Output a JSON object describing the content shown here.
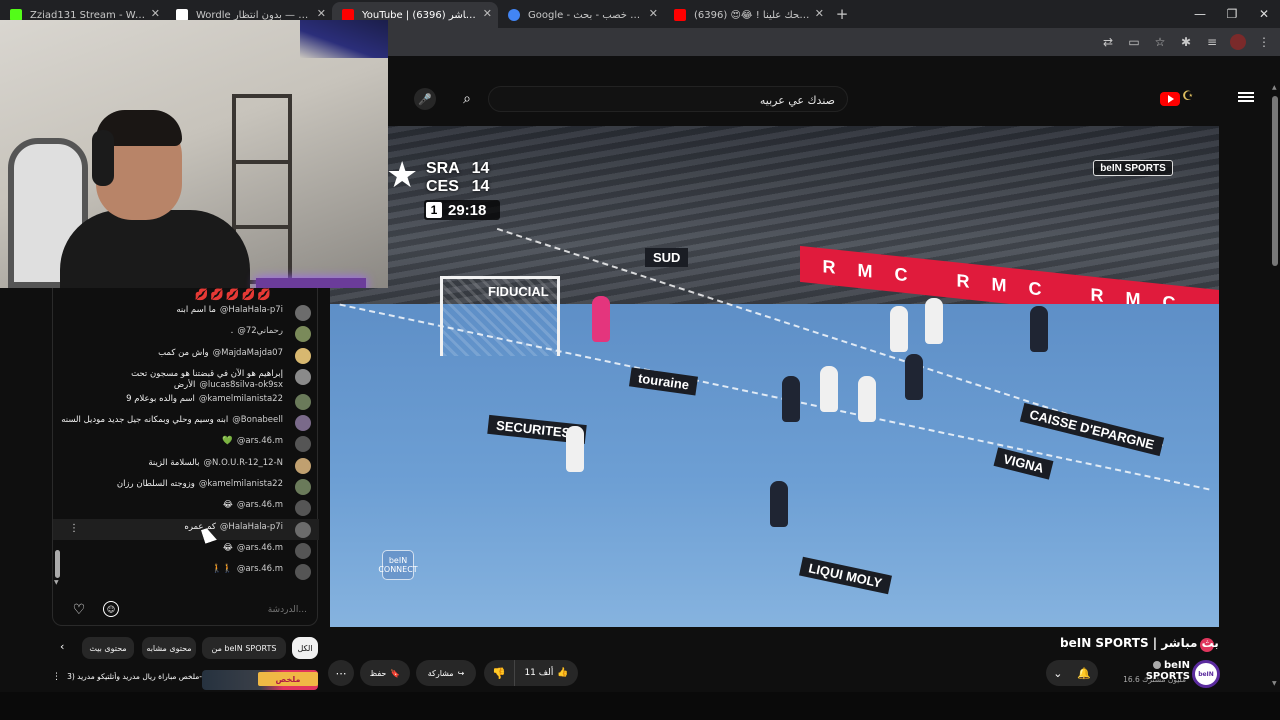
{
  "browser": {
    "tabs": [
      {
        "title": "Zziad131 Stream - Watch Live o",
        "favicon_color": "#53fc18",
        "active": false
      },
      {
        "title": "Wordle بلا حدود — بدون انتظار",
        "favicon_color": "#ffffff",
        "active": false
      },
      {
        "title": "YouTube | بث مباشر (6396)",
        "favicon_color": "#ff0000",
        "active": true
      },
      {
        "title": "Google - مناطق خصب - بحث",
        "favicon_color": "#4285f4",
        "active": false
      },
      {
        "title": "مودي ضحك علينا ! 😂😍 (6396)",
        "favicon_color": "#ff0000",
        "active": false
      }
    ],
    "new_tab_label": "+"
  },
  "youtube": {
    "search": {
      "value": "صندك عي عربيه",
      "placeholder": "بحث"
    },
    "logo_text": "YouTube"
  },
  "video": {
    "scorebug": {
      "home_team": "SRA",
      "home_score": "14",
      "away_team": "CES",
      "away_score": "14",
      "period": "1",
      "clock": "29:18"
    },
    "broadcaster_bug": "beIN SPORTS",
    "connect_bug": "beIN CONNECT",
    "ad_board": "RMC RMC RMC",
    "floor_ads": [
      "SUD",
      "FIDUCIAL",
      "touraine",
      "SECURITEST",
      "CAISSE D'EPARGNE",
      "LIQUI MOLY",
      "VIGNA"
    ],
    "title": "beIN SPORTS | بث مباشر",
    "channel_name": "beIN SPORTS",
    "subscribers": "16.6 مليون مشترك",
    "likes": "11 ألف",
    "share_label": "مشاركة",
    "save_label": "حفظ"
  },
  "chat": {
    "top_emojis": "💋💋💋💋💋",
    "messages": [
      {
        "author": "@HalaHala-p7i",
        "text": "ما اسم ابنه",
        "avatar_color": "#6c6c6c"
      },
      {
        "author": "@رحماني72",
        "text": ".",
        "avatar_color": "#7a8a5a"
      },
      {
        "author": "@MajdaMajda07",
        "text": "واش من كمب",
        "avatar_color": "#d8b870"
      },
      {
        "author": "@lucas8silva-ok9sx",
        "text": "إبراهيم هو الآن في قبضتنا هو مسجون تحت الأرض",
        "avatar_color": "#8a8a8a"
      },
      {
        "author": "@kamelmilanista22",
        "text": "اسم والده بوعلام 9",
        "avatar_color": "#6a7a5a"
      },
      {
        "author": "@Bonabeell",
        "text": "ابنه وسيم وحلي وبمكانه جيل جديد موديل السنه",
        "avatar_color": "#7a6a8a"
      },
      {
        "author": "@ars.46.m",
        "text": "💚",
        "avatar_color": "#555555"
      },
      {
        "author": "@N.O.U.R-12_12-N",
        "text": "بالسلامة الزينة",
        "avatar_color": "#c0a070"
      },
      {
        "author": "@kamelmilanista22",
        "text": "وزوجته السلطان رزان",
        "avatar_color": "#6a7a5a"
      },
      {
        "author": "@ars.46.m",
        "text": "😂",
        "avatar_color": "#555555"
      },
      {
        "author": "@HalaHala-p7i",
        "text": "كم عمره",
        "avatar_color": "#6c6c6c",
        "highlight": true
      },
      {
        "author": "@ars.46.m",
        "text": "😂",
        "avatar_color": "#555555"
      },
      {
        "author": "@ars.46.m",
        "text": "🚶🚶",
        "avatar_color": "#555555"
      }
    ],
    "input_placeholder": "الدردشة..."
  },
  "chips": [
    {
      "label": "الكل",
      "active": true
    },
    {
      "label": "من beIN SPORTS",
      "active": false
    },
    {
      "label": "محتوى مشابه",
      "active": false
    },
    {
      "label": "محتوى بيث",
      "active": false
    }
  ],
  "recommendation": {
    "title": "ملخص مباراة ريال مدريد وأتلتيكو مدريد (3-",
    "badge": "ملخص"
  },
  "colors": {
    "accent": "#ff0000",
    "live": "#e0365d",
    "background": "#0f0f0f"
  }
}
